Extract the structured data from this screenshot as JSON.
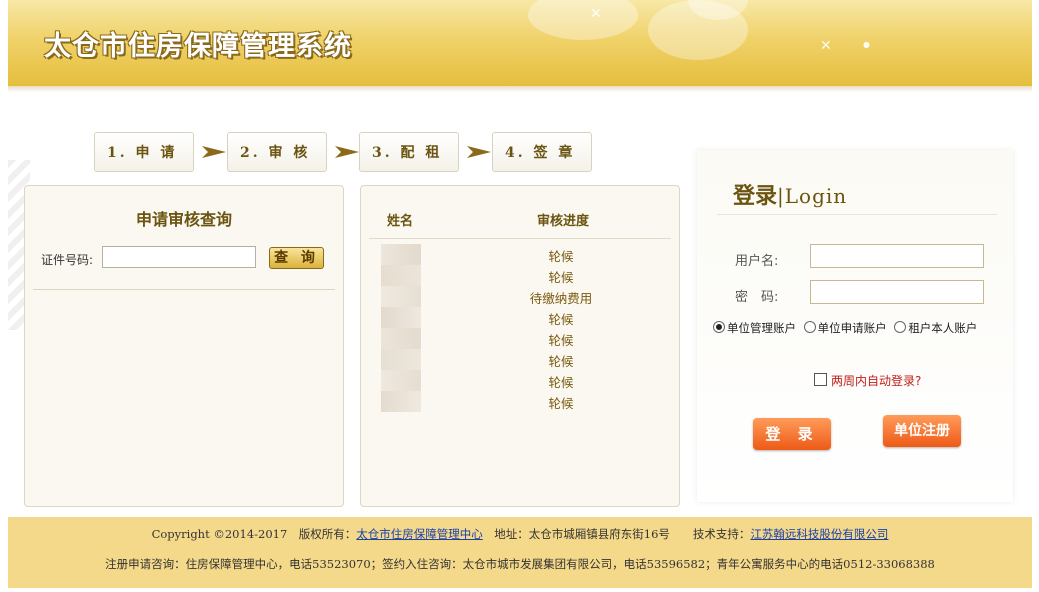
{
  "header": {
    "title": "太仓市住房保障管理系统"
  },
  "steps": [
    {
      "label": "1. 申 请"
    },
    {
      "label": "2. 审 核"
    },
    {
      "label": "3. 配 租"
    },
    {
      "label": "4. 签 章"
    }
  ],
  "query_panel": {
    "title": "申请审核查询",
    "id_label": "证件号码:",
    "id_value": "",
    "query_button": "查 询"
  },
  "progress_panel": {
    "col_name": "姓名",
    "col_status": "审核进度",
    "rows": [
      {
        "status": "轮候"
      },
      {
        "status": "轮候"
      },
      {
        "status": "待缴纳费用"
      },
      {
        "status": "轮候"
      },
      {
        "status": "轮候"
      },
      {
        "status": "轮候"
      },
      {
        "status": "轮候"
      },
      {
        "status": "轮候"
      }
    ]
  },
  "login": {
    "title_main": "登录",
    "title_sub": "|Login",
    "username_label": "用户名:",
    "username_value": "",
    "password_label": "密　码:",
    "password_value": "",
    "account_types": [
      {
        "label": "单位管理账户",
        "selected": true
      },
      {
        "label": "单位申请账户",
        "selected": false
      },
      {
        "label": "租户本人账户",
        "selected": false
      }
    ],
    "remember_label": "两周内自动登录?",
    "login_button": "登 录",
    "register_button": "单位注册"
  },
  "footer": {
    "copyright": "Copyright ©2014-2017　版权所有：",
    "owner_link": "太仓市住房保障管理中心",
    "address": "　地址：太仓市城厢镇县府东街16号　　技术支持：",
    "support_link": "江苏翰远科技股份有限公司",
    "line2": "注册申请咨询：住房保障管理中心，电话53523070；签约入住咨询：太仓市城市发展集团有限公司，电话53596582；青年公寓服务中心的电话0512-33068388"
  },
  "colors": {
    "banner": "#f0d26a",
    "accent": "#6b5310",
    "button": "#ee5a17",
    "footer": "#f5d98a"
  }
}
